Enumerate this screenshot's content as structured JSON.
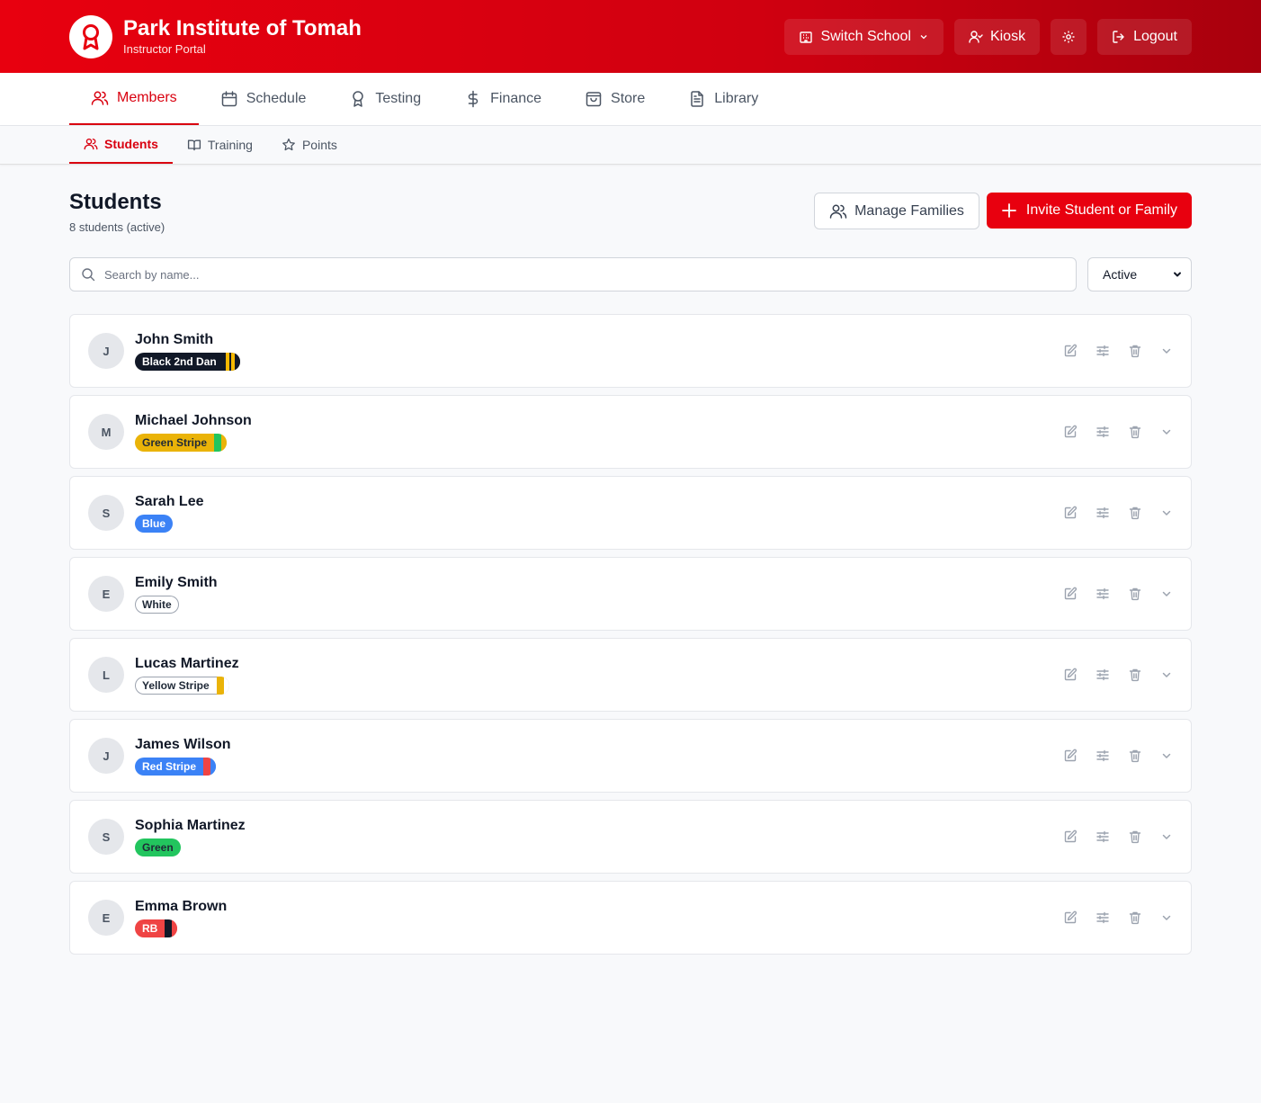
{
  "header": {
    "school_name": "Park Institute of Tomah",
    "portal_name": "Instructor Portal",
    "switch_school_label": "Switch School",
    "kiosk_label": "Kiosk",
    "logout_label": "Logout"
  },
  "main_nav": [
    {
      "label": "Members",
      "icon": "users-icon",
      "active": true
    },
    {
      "label": "Schedule",
      "icon": "calendar-icon",
      "active": false
    },
    {
      "label": "Testing",
      "icon": "award-icon",
      "active": false
    },
    {
      "label": "Finance",
      "icon": "dollar-icon",
      "active": false
    },
    {
      "label": "Store",
      "icon": "shopping-bag-icon",
      "active": false
    },
    {
      "label": "Library",
      "icon": "document-icon",
      "active": false
    }
  ],
  "sub_nav": [
    {
      "label": "Students",
      "icon": "users-icon",
      "active": true
    },
    {
      "label": "Training",
      "icon": "book-icon",
      "active": false
    },
    {
      "label": "Points",
      "icon": "star-icon",
      "active": false
    }
  ],
  "page": {
    "title": "Students",
    "subtitle": "8 students (active)",
    "manage_families_label": "Manage Families",
    "invite_label": "Invite Student or Family",
    "search_placeholder": "Search by name...",
    "status_filter_value": "Active"
  },
  "colors": {
    "brand_red": "#e8000f",
    "accent": "#d9000f"
  },
  "students": [
    {
      "initial": "J",
      "name": "John Smith",
      "belt": "Black 2nd Dan",
      "belt_bg": "#111827",
      "belt_fg": "#ffffff",
      "stripes": [
        "#f5b800",
        "#f5b800"
      ],
      "end": "#111827"
    },
    {
      "initial": "M",
      "name": "Michael Johnson",
      "belt": "Green Stripe",
      "belt_bg": "#eab308",
      "belt_fg": "#1f2937",
      "stripes": [
        "#22c55e"
      ],
      "end": "#eab308"
    },
    {
      "initial": "S",
      "name": "Sarah Lee",
      "belt": "Blue",
      "belt_bg": "#3b82f6",
      "belt_fg": "#ffffff",
      "stripes": [],
      "end": ""
    },
    {
      "initial": "E",
      "name": "Emily Smith",
      "belt": "White",
      "belt_bg": "#ffffff",
      "belt_fg": "#1f2937",
      "stripes": [],
      "end": "",
      "bordered": true
    },
    {
      "initial": "L",
      "name": "Lucas Martinez",
      "belt": "Yellow Stripe",
      "belt_bg": "#ffffff",
      "belt_fg": "#1f2937",
      "stripes": [
        "#eab308"
      ],
      "end": "#ffffff",
      "bordered": true
    },
    {
      "initial": "J",
      "name": "James Wilson",
      "belt": "Red Stripe",
      "belt_bg": "#3b82f6",
      "belt_fg": "#ffffff",
      "stripes": [
        "#ef4444"
      ],
      "end": "#3b82f6"
    },
    {
      "initial": "S",
      "name": "Sophia Martinez",
      "belt": "Green",
      "belt_bg": "#22c55e",
      "belt_fg": "#1f2937",
      "stripes": [],
      "end": ""
    },
    {
      "initial": "E",
      "name": "Emma Brown",
      "belt": "RB",
      "belt_bg": "#ef4444",
      "belt_fg": "#ffffff",
      "stripes": [
        "#111827"
      ],
      "end": "#ef4444"
    }
  ]
}
